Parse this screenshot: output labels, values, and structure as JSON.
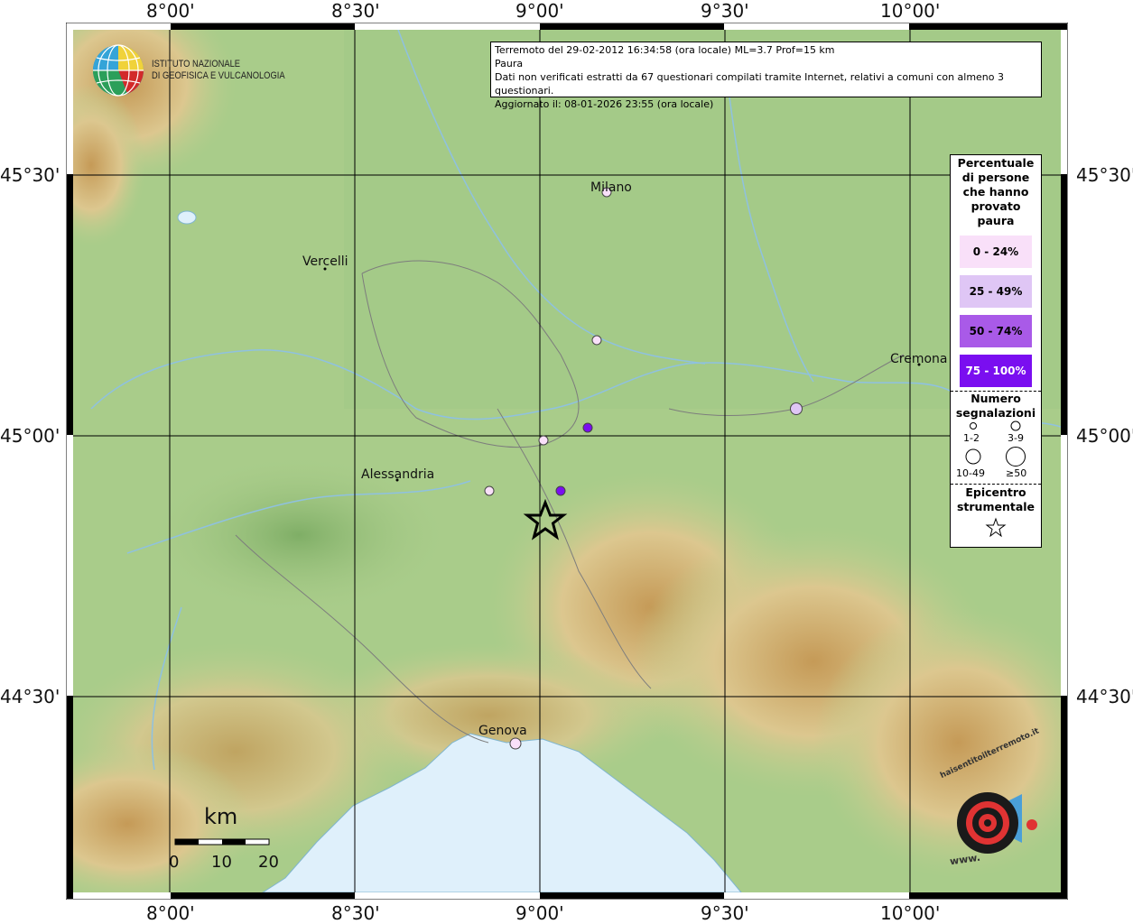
{
  "axes": {
    "lon_labels": [
      "8°00'",
      "8°30'",
      "9°00'",
      "9°30'",
      "10°00'"
    ],
    "lat_labels": [
      "45°30'",
      "45°00'",
      "44°30'"
    ]
  },
  "info": {
    "line1": "Terremoto del 29-02-2012 16:34:58 (ora locale) ML=3.7 Prof=15 km",
    "line2": "Paura",
    "line3": "Dati non verificati estratti da 67 questionari compilati tramite Internet, relativi a comuni con almeno 3 questionari.",
    "line4": "Aggiornato il: 08-01-2026 23:55 (ora locale)"
  },
  "logo": {
    "line1": "ISTITUTO NAZIONALE",
    "line2": "DI GEOFISICA E VULCANOLOGIA"
  },
  "legend": {
    "title": [
      "Percentuale",
      "di persone",
      "che hanno",
      "provato",
      "paura"
    ],
    "classes": [
      {
        "label": "0 - 24%",
        "color": "#f9e0f9"
      },
      {
        "label": "25 - 49%",
        "color": "#dfc6f5"
      },
      {
        "label": "50 - 74%",
        "color": "#a95ae8"
      },
      {
        "label": "75 - 100%",
        "color": "#7a0ef0"
      }
    ],
    "count_title": [
      "Numero",
      "segnalazioni"
    ],
    "counts": [
      "1-2",
      "3-9",
      "10-49",
      "≥50"
    ],
    "epicenter_title": [
      "Epicentro",
      "strumentale"
    ]
  },
  "cities": [
    "Milano",
    "Vercelli",
    "Cremona",
    "Alessandria",
    "Genova"
  ],
  "scale": {
    "unit": "km",
    "ticks": [
      "0",
      "10",
      "20"
    ]
  },
  "stamp": {
    "text": "haisentitoilterremoto.it",
    "url_text": "www."
  },
  "colors": {
    "sea": "#dff0fb",
    "plain": "#a9cc8a",
    "hills": "#e4d3a0",
    "mountains": "#b98a45"
  }
}
